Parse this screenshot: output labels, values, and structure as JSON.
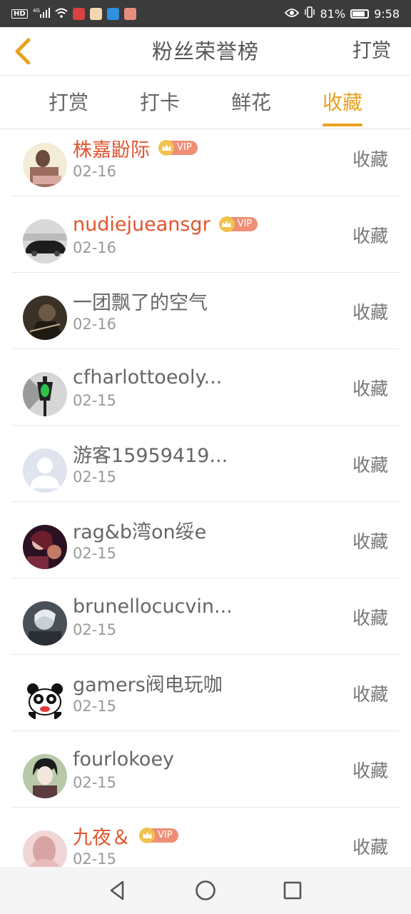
{
  "status_bar": {
    "left_icons": [
      "hd-icon",
      "signal-4g-icon",
      "wifi-icon",
      "app-icon-red",
      "app-icon-character",
      "app-icon-blue",
      "app-icon-fm"
    ],
    "battery": "81%",
    "time": "9:58"
  },
  "header": {
    "title": "粉丝荣誉榜",
    "action": "打赏",
    "accent_color": "#e9a21f"
  },
  "tabs": [
    {
      "label": "打赏",
      "active": false
    },
    {
      "label": "打卡",
      "active": false
    },
    {
      "label": "鲜花",
      "active": false
    },
    {
      "label": "收藏",
      "active": true
    }
  ],
  "vip_label": "VIP",
  "rows": [
    {
      "name": "株嘉鼢际",
      "date": "02-16",
      "vip": true,
      "action": "收藏"
    },
    {
      "name": "nudiejueansgr",
      "date": "02-16",
      "vip": true,
      "action": "收藏"
    },
    {
      "name": "一团飘了的空气",
      "date": "02-16",
      "vip": false,
      "action": "收藏"
    },
    {
      "name": "cfharlottoeoly...",
      "date": "02-15",
      "vip": false,
      "action": "收藏"
    },
    {
      "name": "游客15959419...",
      "date": "02-15",
      "vip": false,
      "action": "收藏"
    },
    {
      "name": "rag&b湾on绥e",
      "date": "02-15",
      "vip": false,
      "action": "收藏"
    },
    {
      "name": "brunellocucvin...",
      "date": "02-15",
      "vip": false,
      "action": "收藏"
    },
    {
      "name": "gamers阀电玩咖",
      "date": "02-15",
      "vip": false,
      "action": "收藏"
    },
    {
      "name": "fourlokoey",
      "date": "02-15",
      "vip": false,
      "action": "收藏"
    },
    {
      "name": "九夜＆",
      "date": "02-15",
      "vip": true,
      "action": "收藏"
    }
  ]
}
